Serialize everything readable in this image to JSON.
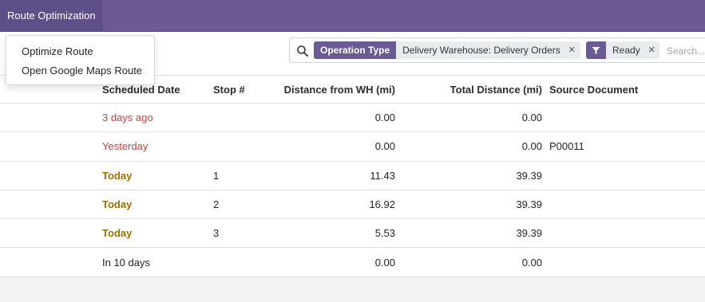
{
  "nav": {
    "menu_label": "Route Optimization"
  },
  "dropdown": {
    "items": [
      {
        "label": "Optimize Route"
      },
      {
        "label": "Open Google Maps Route"
      }
    ]
  },
  "search": {
    "facets": [
      {
        "label": "Operation Type",
        "value": "Delivery Warehouse: Delivery Orders",
        "remove_icon": "close-icon"
      },
      {
        "icon": "filter-icon",
        "value": "Ready",
        "remove_icon": "close-icon"
      }
    ],
    "placeholder": "Search..."
  },
  "table": {
    "columns": {
      "scheduled_date": "Scheduled Date",
      "stop": "Stop #",
      "distance_wh": "Distance from WH (mi)",
      "total_distance": "Total Distance (mi)",
      "source_document": "Source Document"
    },
    "rows": [
      {
        "scheduled_date": "3 days ago",
        "date_status": "overdue",
        "stop": "",
        "distance_wh": "0.00",
        "total_distance": "0.00",
        "source_document": ""
      },
      {
        "scheduled_date": "Yesterday",
        "date_status": "overdue",
        "stop": "",
        "distance_wh": "0.00",
        "total_distance": "0.00",
        "source_document": "P00011"
      },
      {
        "scheduled_date": "Today",
        "date_status": "today",
        "stop": "1",
        "distance_wh": "11.43",
        "total_distance": "39.39",
        "source_document": ""
      },
      {
        "scheduled_date": "Today",
        "date_status": "today",
        "stop": "2",
        "distance_wh": "16.92",
        "total_distance": "39.39",
        "source_document": ""
      },
      {
        "scheduled_date": "Today",
        "date_status": "today",
        "stop": "3",
        "distance_wh": "5.53",
        "total_distance": "39.39",
        "source_document": ""
      },
      {
        "scheduled_date": "In 10 days",
        "date_status": "future",
        "stop": "",
        "distance_wh": "0.00",
        "total_distance": "0.00",
        "source_document": ""
      }
    ]
  },
  "colors": {
    "brand": "#6c5a94",
    "overdue": "#d23f3a",
    "today": "#9c6f04"
  }
}
